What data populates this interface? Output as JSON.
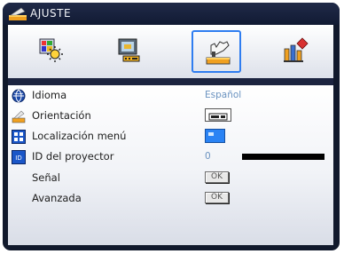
{
  "header": {
    "title": "AJUSTE",
    "title_icon": "setup-icon"
  },
  "tabs": [
    {
      "name": "image-tab",
      "icon": "image-settings-icon",
      "selected": false
    },
    {
      "name": "display-tab",
      "icon": "display-settings-icon",
      "selected": false
    },
    {
      "name": "setup-tab",
      "icon": "setup-hand-icon",
      "selected": true
    },
    {
      "name": "options-tab",
      "icon": "options-icon",
      "selected": false
    }
  ],
  "menu": {
    "idioma": {
      "label": "Idioma",
      "value": "Español",
      "icon": "language-globe-icon"
    },
    "orientacion": {
      "label": "Orientación",
      "icon": "projection-icon",
      "value_icon": "front-projection-icon"
    },
    "localizacion": {
      "label": "Localización menú",
      "icon": "menu-location-icon",
      "value_icon": "menu-top-left-icon"
    },
    "id_proyector": {
      "label": "ID del proyector",
      "value": "0",
      "icon": "projector-id-icon",
      "slider_level": 0
    },
    "senal": {
      "label": "Señal",
      "button": "OK"
    },
    "avanzada": {
      "label": "Avanzada",
      "button": "OK"
    }
  },
  "colors": {
    "selected_tab_border": "#2f7df0",
    "value_text": "#6b93c0",
    "frame": "#11192c"
  }
}
